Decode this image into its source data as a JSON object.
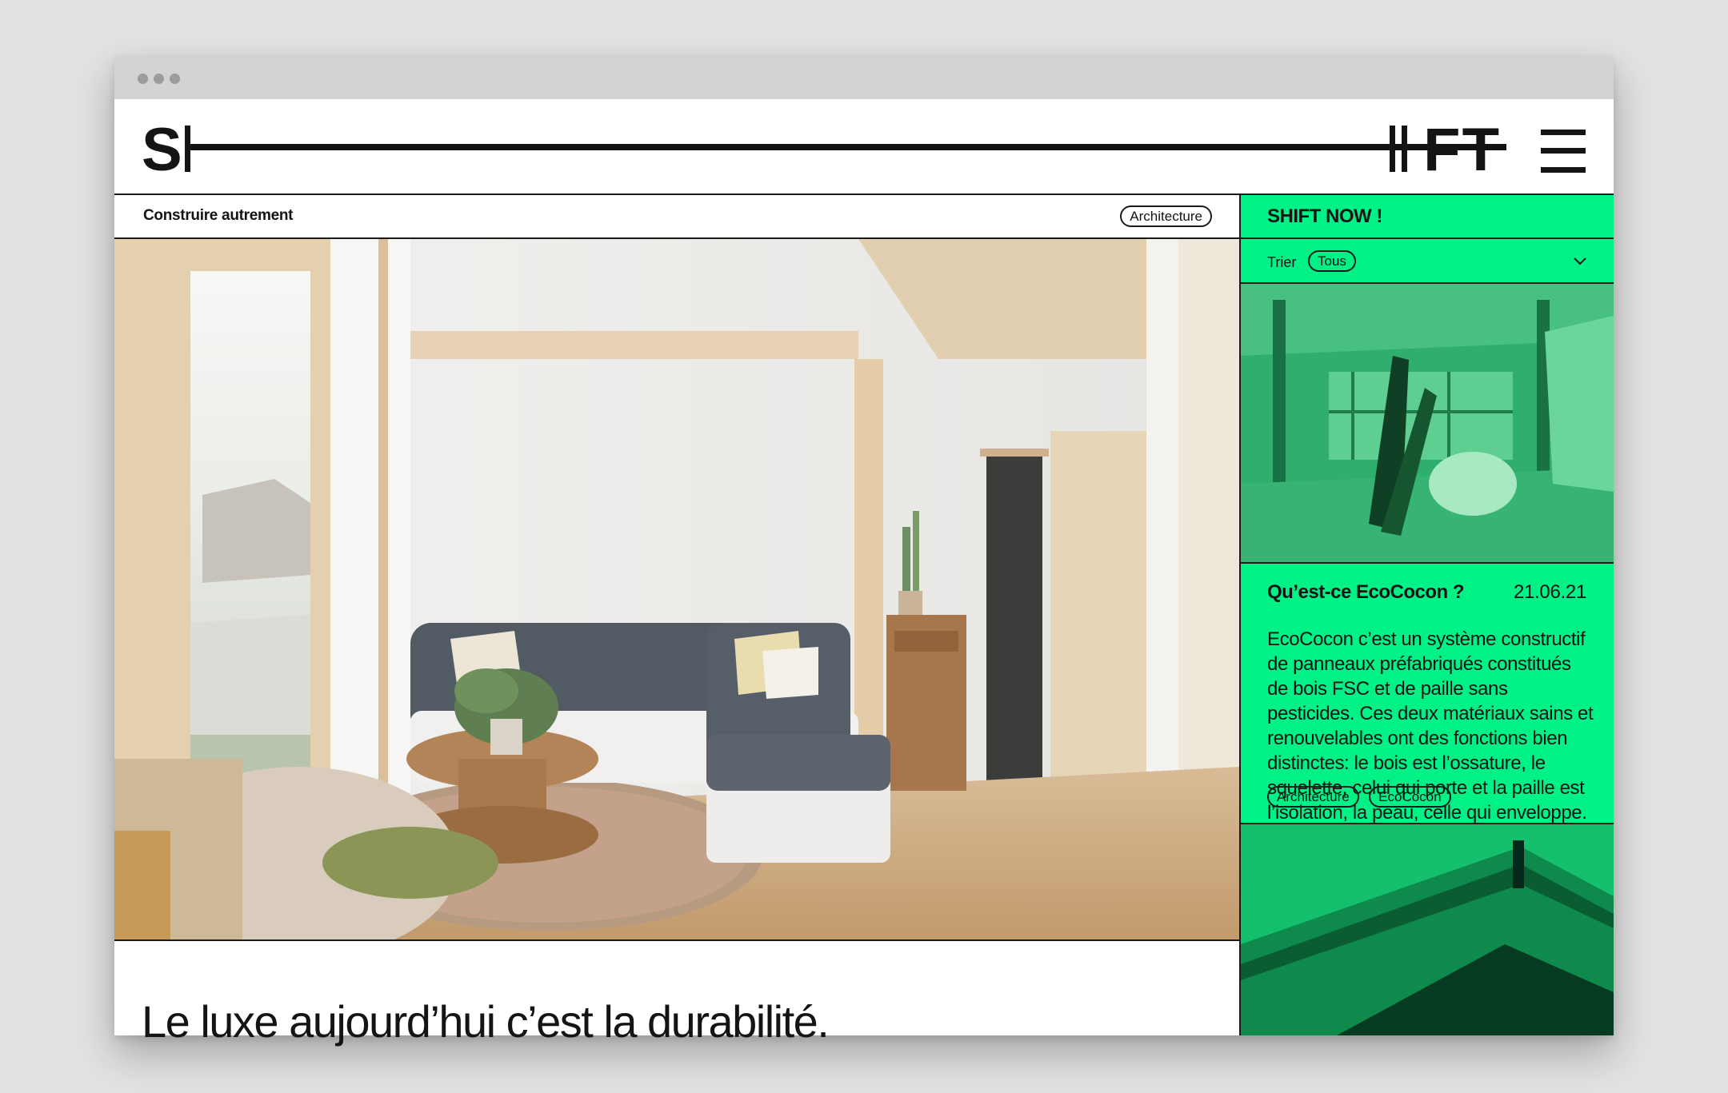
{
  "browser": {
    "window_dots": 3
  },
  "logo": {
    "left": "S",
    "right": "FT"
  },
  "header": {
    "menu_icon": "hamburger-icon"
  },
  "article": {
    "section_title": "Construire autrement",
    "tag": "Architecture",
    "headline": "Le luxe aujourd’hui c’est la durabilité."
  },
  "sidebar": {
    "title": "SHIFT NOW !",
    "sort_label": "Trier",
    "sort_value": "Tous",
    "card": {
      "title": "Qu’est-ce EcoCocon ?",
      "date": "21.06.21",
      "text": "EcoCocon c’est un système constructif de panneaux préfabriqués constitués de bois FSC et de paille sans pesticides. Ces deux matériaux sains et renouvelables ont des fonctions bien distinctes: le bois est l’ossature, le squelette, celui qui porte et la paille est l’isolation, la peau, celle qui enveloppe.",
      "tags": [
        "Architecture",
        "EcoCocon"
      ]
    }
  },
  "colors": {
    "accent": "#00f287",
    "ink": "#141414",
    "background": "#e2e2e2"
  }
}
